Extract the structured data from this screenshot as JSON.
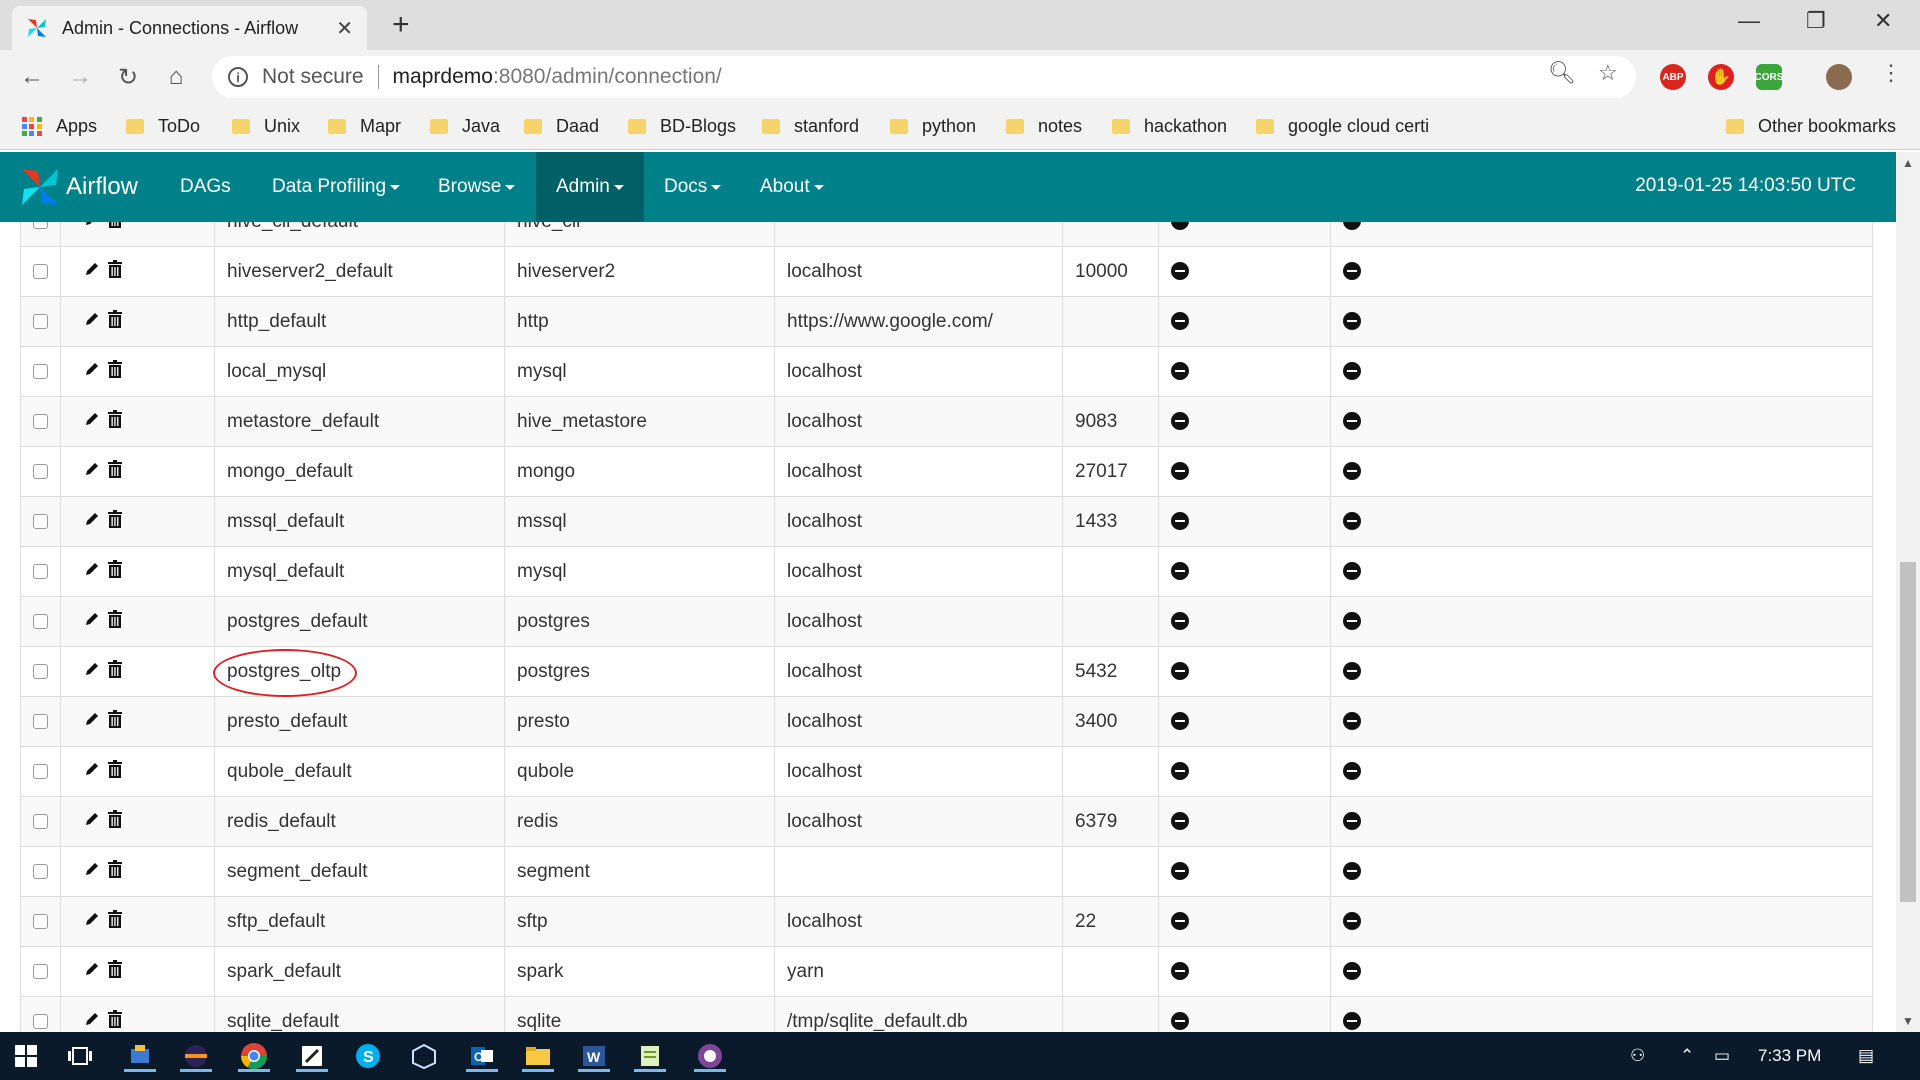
{
  "browser": {
    "tab_title": "Admin - Connections - Airflow",
    "security_label": "Not secure",
    "url_host": "maprdemo",
    "url_path": ":8080/admin/connection/",
    "bookmarks": [
      "Apps",
      "ToDo",
      "Unix",
      "Mapr",
      "Java",
      "Daad",
      "BD-Blogs",
      "stanford",
      "python",
      "notes",
      "hackathon",
      "google cloud certi"
    ],
    "other_bookmarks": "Other bookmarks",
    "extensions": [
      "ABP",
      "CORS"
    ]
  },
  "airflow": {
    "brand": "Airflow",
    "menu": [
      {
        "label": "DAGs",
        "dropdown": false
      },
      {
        "label": "Data Profiling",
        "dropdown": true
      },
      {
        "label": "Browse",
        "dropdown": true
      },
      {
        "label": "Admin",
        "dropdown": true,
        "active": true
      },
      {
        "label": "Docs",
        "dropdown": true
      },
      {
        "label": "About",
        "dropdown": true
      }
    ],
    "timestamp": "2019-01-25 14:03:50 UTC"
  },
  "connections": [
    {
      "conn_id": "hive_cli_default",
      "type": "hive_cli",
      "host": "",
      "port": ""
    },
    {
      "conn_id": "hiveserver2_default",
      "type": "hiveserver2",
      "host": "localhost",
      "port": "10000"
    },
    {
      "conn_id": "http_default",
      "type": "http",
      "host": "https://www.google.com/",
      "port": ""
    },
    {
      "conn_id": "local_mysql",
      "type": "mysql",
      "host": "localhost",
      "port": ""
    },
    {
      "conn_id": "metastore_default",
      "type": "hive_metastore",
      "host": "localhost",
      "port": "9083"
    },
    {
      "conn_id": "mongo_default",
      "type": "mongo",
      "host": "localhost",
      "port": "27017"
    },
    {
      "conn_id": "mssql_default",
      "type": "mssql",
      "host": "localhost",
      "port": "1433"
    },
    {
      "conn_id": "mysql_default",
      "type": "mysql",
      "host": "localhost",
      "port": ""
    },
    {
      "conn_id": "postgres_default",
      "type": "postgres",
      "host": "localhost",
      "port": ""
    },
    {
      "conn_id": "postgres_oltp",
      "type": "postgres",
      "host": "localhost",
      "port": "5432",
      "highlighted": true
    },
    {
      "conn_id": "presto_default",
      "type": "presto",
      "host": "localhost",
      "port": "3400"
    },
    {
      "conn_id": "qubole_default",
      "type": "qubole",
      "host": "localhost",
      "port": ""
    },
    {
      "conn_id": "redis_default",
      "type": "redis",
      "host": "localhost",
      "port": "6379"
    },
    {
      "conn_id": "segment_default",
      "type": "segment",
      "host": "",
      "port": ""
    },
    {
      "conn_id": "sftp_default",
      "type": "sftp",
      "host": "localhost",
      "port": "22"
    },
    {
      "conn_id": "spark_default",
      "type": "spark",
      "host": "yarn",
      "port": ""
    },
    {
      "conn_id": "sqlite_default",
      "type": "sqlite",
      "host": "/tmp/sqlite_default.db",
      "port": ""
    }
  ],
  "taskbar": {
    "time": "7:33 PM"
  },
  "colors": {
    "navbar": "#00818a",
    "navbar_active": "#006066",
    "highlight_circle": "#d22222"
  }
}
